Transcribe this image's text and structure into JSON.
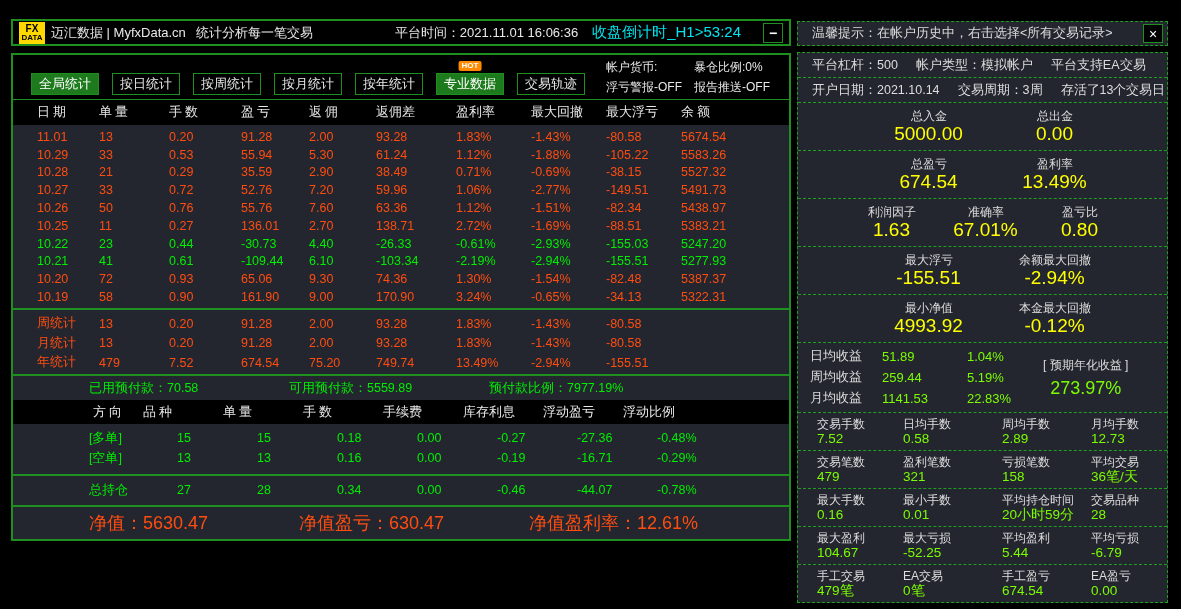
{
  "title_bar": {
    "logo": [
      "FX",
      "DATA"
    ],
    "brand": "迈汇数据 | MyfxData.cn",
    "slogan": "统计分析每一笔交易",
    "time": "平台时间：2021.11.01 16:06:36",
    "countdown": "收盘倒计时_H1>53:24",
    "minimize": "−"
  },
  "toolbar": {
    "buttons": [
      {
        "label": "全局统计",
        "selected": true
      },
      {
        "label": "按日统计",
        "selected": false
      },
      {
        "label": "按周统计",
        "selected": false
      },
      {
        "label": "按月统计",
        "selected": false
      },
      {
        "label": "按年统计",
        "selected": false
      },
      {
        "label": "专业数据",
        "selected": true,
        "badge": "HOT"
      },
      {
        "label": "交易轨迹",
        "selected": false
      }
    ],
    "info": [
      "帐户货币:",
      "暴仓比例:0%",
      "浮亏警报-OFF",
      "报告推送-OFF"
    ]
  },
  "table": {
    "columns": [
      "日 期",
      "单 量",
      "手 数",
      "盈 亏",
      "返 佣",
      "返佣差",
      "盈利率",
      "最大回撤",
      "最大浮亏",
      "余 额"
    ],
    "rows": [
      {
        "loss": false,
        "cells": [
          "11.01",
          "13",
          "0.20",
          "91.28",
          "2.00",
          "93.28",
          "1.83%",
          "-1.43%",
          "-80.58",
          "5674.54"
        ]
      },
      {
        "loss": false,
        "cells": [
          "10.29",
          "33",
          "0.53",
          "55.94",
          "5.30",
          "61.24",
          "1.12%",
          "-1.88%",
          "-105.22",
          "5583.26"
        ]
      },
      {
        "loss": false,
        "cells": [
          "10.28",
          "21",
          "0.29",
          "35.59",
          "2.90",
          "38.49",
          "0.71%",
          "-0.69%",
          "-38.15",
          "5527.32"
        ]
      },
      {
        "loss": false,
        "cells": [
          "10.27",
          "33",
          "0.72",
          "52.76",
          "7.20",
          "59.96",
          "1.06%",
          "-2.77%",
          "-149.51",
          "5491.73"
        ]
      },
      {
        "loss": false,
        "cells": [
          "10.26",
          "50",
          "0.76",
          "55.76",
          "7.60",
          "63.36",
          "1.12%",
          "-1.51%",
          "-82.34",
          "5438.97"
        ]
      },
      {
        "loss": false,
        "cells": [
          "10.25",
          "11",
          "0.27",
          "136.01",
          "2.70",
          "138.71",
          "2.72%",
          "-1.69%",
          "-88.51",
          "5383.21"
        ]
      },
      {
        "loss": true,
        "cells": [
          "10.22",
          "23",
          "0.44",
          "-30.73",
          "4.40",
          "-26.33",
          "-0.61%",
          "-2.93%",
          "-155.03",
          "5247.20"
        ]
      },
      {
        "loss": true,
        "cells": [
          "10.21",
          "41",
          "0.61",
          "-109.44",
          "6.10",
          "-103.34",
          "-2.19%",
          "-2.94%",
          "-155.51",
          "5277.93"
        ]
      },
      {
        "loss": false,
        "cells": [
          "10.20",
          "72",
          "0.93",
          "65.06",
          "9.30",
          "74.36",
          "1.30%",
          "-1.54%",
          "-82.48",
          "5387.37"
        ]
      },
      {
        "loss": false,
        "cells": [
          "10.19",
          "58",
          "0.90",
          "161.90",
          "9.00",
          "170.90",
          "3.24%",
          "-0.65%",
          "-34.13",
          "5322.31"
        ]
      }
    ],
    "summary": [
      [
        "周统计",
        "13",
        "0.20",
        "91.28",
        "2.00",
        "93.28",
        "1.83%",
        "-1.43%",
        "-80.58"
      ],
      [
        "月统计",
        "13",
        "0.20",
        "91.28",
        "2.00",
        "93.28",
        "1.83%",
        "-1.43%",
        "-80.58"
      ],
      [
        "年统计",
        "479",
        "7.52",
        "674.54",
        "75.20",
        "749.74",
        "13.49%",
        "-2.94%",
        "-155.51"
      ]
    ]
  },
  "prepay": [
    "已用预付款：70.58",
    "可用预付款：5559.89",
    "预付款比例：7977.19%"
  ],
  "positions": {
    "columns": [
      "方 向",
      "品 种",
      "单 量",
      "手 数",
      "手续费",
      "库存利息",
      "浮动盈亏",
      "浮动比例"
    ],
    "rows": [
      [
        "[多单]",
        "15",
        "15",
        "0.18",
        "0.00",
        "-0.27",
        "-27.36",
        "-0.48%"
      ],
      [
        "[空单]",
        "13",
        "13",
        "0.16",
        "0.00",
        "-0.19",
        "-16.71",
        "-0.29%"
      ]
    ],
    "total": [
      "总持仓",
      "27",
      "28",
      "0.34",
      "0.00",
      "-0.46",
      "-44.07",
      "-0.78%"
    ]
  },
  "net": [
    "净值：5630.47",
    "净值盈亏：630.47",
    "净值盈利率：12.61%"
  ],
  "tip": {
    "text": "温馨提示：在帐户历史中，右击选择<所有交易记录>",
    "close": "×"
  },
  "account": [
    [
      "平台杠杆：500",
      "帐户类型：模拟帐户",
      "平台支持EA交易"
    ],
    [
      "开户日期：2021.10.14",
      "交易周期：3周",
      "存活了13个交易日"
    ]
  ],
  "big_stats": [
    [
      {
        "label": "总入金",
        "value": "5000.00"
      },
      {
        "label": "总出金",
        "value": "0.00"
      }
    ],
    [
      {
        "label": "总盈亏",
        "value": "674.54"
      },
      {
        "label": "盈利率",
        "value": "13.49%"
      }
    ],
    [
      {
        "label": "利润因子",
        "value": "1.63"
      },
      {
        "label": "准确率",
        "value": "67.01%"
      },
      {
        "label": "盈亏比",
        "value": "0.80"
      }
    ],
    [
      {
        "label": "最大浮亏",
        "value": "-155.51"
      },
      {
        "label": "余额最大回撤",
        "value": "-2.94%"
      }
    ],
    [
      {
        "label": "最小净值",
        "value": "4993.92"
      },
      {
        "label": "本金最大回撤",
        "value": "-0.12%"
      }
    ]
  ],
  "averages": {
    "rows": [
      {
        "label": "日均收益",
        "amount": "51.89",
        "pct": "1.04%"
      },
      {
        "label": "周均收益",
        "amount": "259.44",
        "pct": "5.19%"
      },
      {
        "label": "月均收益",
        "amount": "1141.53",
        "pct": "22.83%"
      }
    ],
    "annual_label": "[ 预期年化收益 ]",
    "annual_value": "273.97%"
  },
  "grid_stats": [
    [
      {
        "label": "交易手数",
        "value": "7.52"
      },
      {
        "label": "日均手数",
        "value": "0.58"
      },
      {
        "label": "周均手数",
        "value": "2.89"
      },
      {
        "label": "月均手数",
        "value": "12.73"
      }
    ],
    [
      {
        "label": "交易笔数",
        "value": "479"
      },
      {
        "label": "盈利笔数",
        "value": "321"
      },
      {
        "label": "亏损笔数",
        "value": "158"
      },
      {
        "label": "平均交易",
        "value": "36笔/天"
      }
    ],
    [
      {
        "label": "最大手数",
        "value": "0.16"
      },
      {
        "label": "最小手数",
        "value": "0.01"
      },
      {
        "label": "平均持仓时间",
        "value": "20小时59分"
      },
      {
        "label": "交易品种",
        "value": "28"
      }
    ],
    [
      {
        "label": "最大盈利",
        "value": "104.67"
      },
      {
        "label": "最大亏损",
        "value": "-52.25"
      },
      {
        "label": "平均盈利",
        "value": "5.44"
      },
      {
        "label": "平均亏损",
        "value": "-6.79"
      }
    ],
    [
      {
        "label": "手工交易",
        "value": "479笔"
      },
      {
        "label": "EA交易",
        "value": "0笔"
      },
      {
        "label": "手工盈亏",
        "value": "674.54"
      },
      {
        "label": "EA盈亏",
        "value": "0.00"
      }
    ]
  ]
}
